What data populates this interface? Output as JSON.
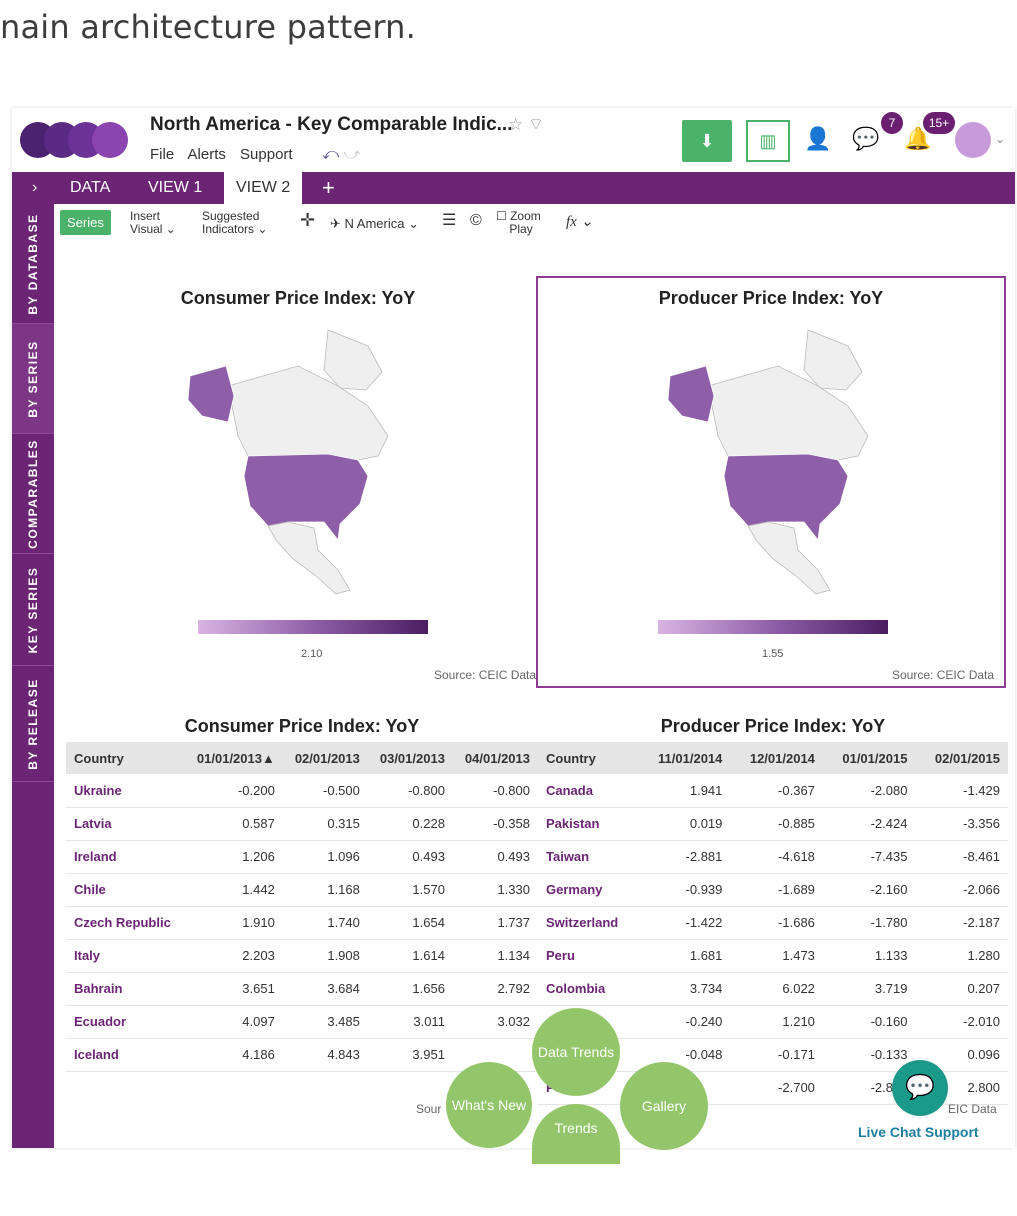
{
  "caption": "nain architecture pattern.",
  "header": {
    "title": "North America - Key Comparable Indic...",
    "menu": [
      "File",
      "Alerts",
      "Support"
    ],
    "badge_messages": "7",
    "badge_alerts": "15+"
  },
  "tabs": [
    "DATA",
    "VIEW 1",
    "VIEW 2"
  ],
  "toolbar": {
    "series": "Series",
    "insert_visual_1": "Insert",
    "insert_visual_2": "Visual",
    "suggested_1": "Suggested",
    "suggested_2": "Indicators",
    "region": "N America",
    "zoom_1": "Zoom",
    "zoom_2": "Play",
    "fx": "fx"
  },
  "sidebar": [
    "BY DATABASE",
    "BY SERIES",
    "COMPARABLES",
    "KEY SERIES",
    "BY RELEASE"
  ],
  "maps": [
    {
      "title": "Consumer Price Index: YoY",
      "legend_value": "2.10",
      "source": "Source: CEIC Data"
    },
    {
      "title": "Producer Price Index: YoY",
      "legend_value": "1.55",
      "source": "Source: CEIC Data"
    }
  ],
  "cpi_table": {
    "title": "Consumer Price Index: YoY",
    "headers": [
      "Country",
      "01/01/2013▲",
      "02/01/2013",
      "03/01/2013",
      "04/01/2013"
    ],
    "rows": [
      [
        "Ukraine",
        "-0.200",
        "-0.500",
        "-0.800",
        "-0.800"
      ],
      [
        "Latvia",
        "0.587",
        "0.315",
        "0.228",
        "-0.358"
      ],
      [
        "Ireland",
        "1.206",
        "1.096",
        "0.493",
        "0.493"
      ],
      [
        "Chile",
        "1.442",
        "1.168",
        "1.570",
        "1.330"
      ],
      [
        "Czech Republic",
        "1.910",
        "1.740",
        "1.654",
        "1.737"
      ],
      [
        "Italy",
        "2.203",
        "1.908",
        "1.614",
        "1.134"
      ],
      [
        "Bahrain",
        "3.651",
        "3.684",
        "1.656",
        "2.792"
      ],
      [
        "Ecuador",
        "4.097",
        "3.485",
        "3.011",
        "3.032"
      ],
      [
        "Iceland",
        "4.186",
        "4.843",
        "3.951",
        ""
      ]
    ],
    "source": "Sour"
  },
  "ppi_table": {
    "title": "Producer Price Index: YoY",
    "headers": [
      "Country",
      "11/01/2014",
      "12/01/2014",
      "01/01/2015",
      "02/01/2015"
    ],
    "rows": [
      [
        "Canada",
        "1.941",
        "-0.367",
        "-2.080",
        "-1.429"
      ],
      [
        "Pakistan",
        "0.019",
        "-0.885",
        "-2.424",
        "-3.356"
      ],
      [
        "Taiwan",
        "-2.881",
        "-4.618",
        "-7.435",
        "-8.461"
      ],
      [
        "Germany",
        "-0.939",
        "-1.689",
        "-2.160",
        "-2.066"
      ],
      [
        "Switzerland",
        "-1.422",
        "-1.686",
        "-1.780",
        "-2.187"
      ],
      [
        "Peru",
        "1.681",
        "1.473",
        "1.133",
        "1.280"
      ],
      [
        "Colombia",
        "3.734",
        "6.022",
        "3.719",
        "0.207"
      ],
      [
        "",
        "-0.240",
        "1.210",
        "-0.160",
        "-2.010"
      ],
      [
        "",
        "-0.048",
        "-0.171",
        "-0.133",
        "0.096"
      ],
      [
        "Po",
        "",
        "-2.700",
        "-2.800",
        "2.800"
      ]
    ],
    "source": "EIC Data"
  },
  "bubbles": {
    "data_trends": "Data Trends",
    "whats_new": "What's New",
    "gallery": "Gallery",
    "trends": "Trends"
  },
  "live_chat": "Live Chat Support",
  "colors": {
    "purple": "#6b2574",
    "green": "#4bb26a",
    "map_fill": "#8e5fa8"
  }
}
